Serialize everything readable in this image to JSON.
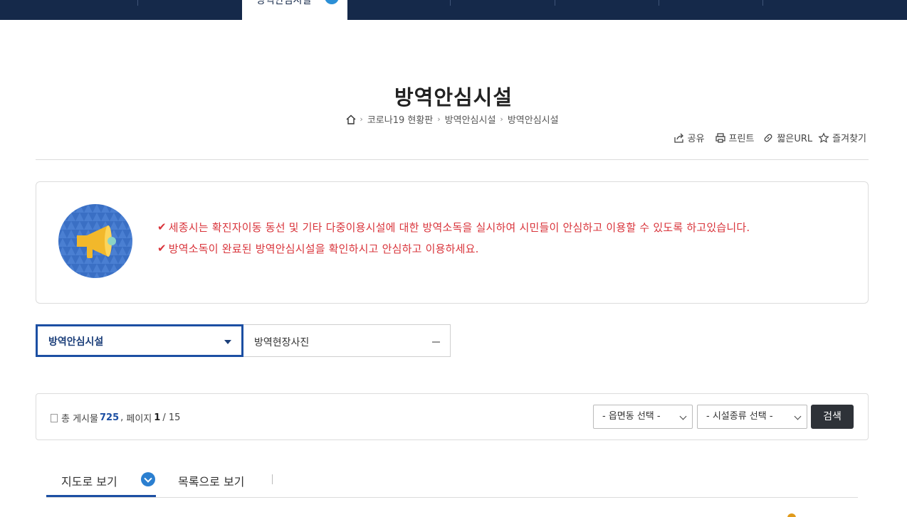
{
  "nav": {
    "items": [
      "",
      "",
      "방역안심시설",
      "",
      "",
      "",
      "",
      ""
    ],
    "active_index": 2
  },
  "page": {
    "title": "방역안심시설",
    "breadcrumb": [
      "코로나19 현황판",
      "방역안심시설",
      "방역안심시설"
    ]
  },
  "utility": {
    "share": "공유",
    "print": "프린트",
    "short_url": "짧은URL",
    "bookmark": "즐겨찾기"
  },
  "notice": {
    "lines": [
      "세종시는 확진자이동 동선 및 기타 다중이용시설에 대한 방역소독을 실시하여 시민들이 안심하고 이용할 수 있도록 하고있습니다.",
      "방역소독이 완료된 방역안심시설을 확인하시고 안심하고 이용하세요."
    ],
    "accent_color": "#d9343b"
  },
  "tabs": {
    "selected": "방역안심시설",
    "other": "방역현장사진"
  },
  "board": {
    "total_label": "총 게시물",
    "total": "725",
    "page_label": "페이지",
    "page_current": "1",
    "page_total": "/ 15",
    "district_select": "- 읍면동 선택 -",
    "type_select": "- 시설종류 선택 -",
    "search_button": "검색"
  },
  "view": {
    "map": "지도로 보기",
    "list": "목록으로 보기"
  },
  "colors": {
    "navy": "#15294a",
    "brand_blue": "#1c4fa3"
  }
}
